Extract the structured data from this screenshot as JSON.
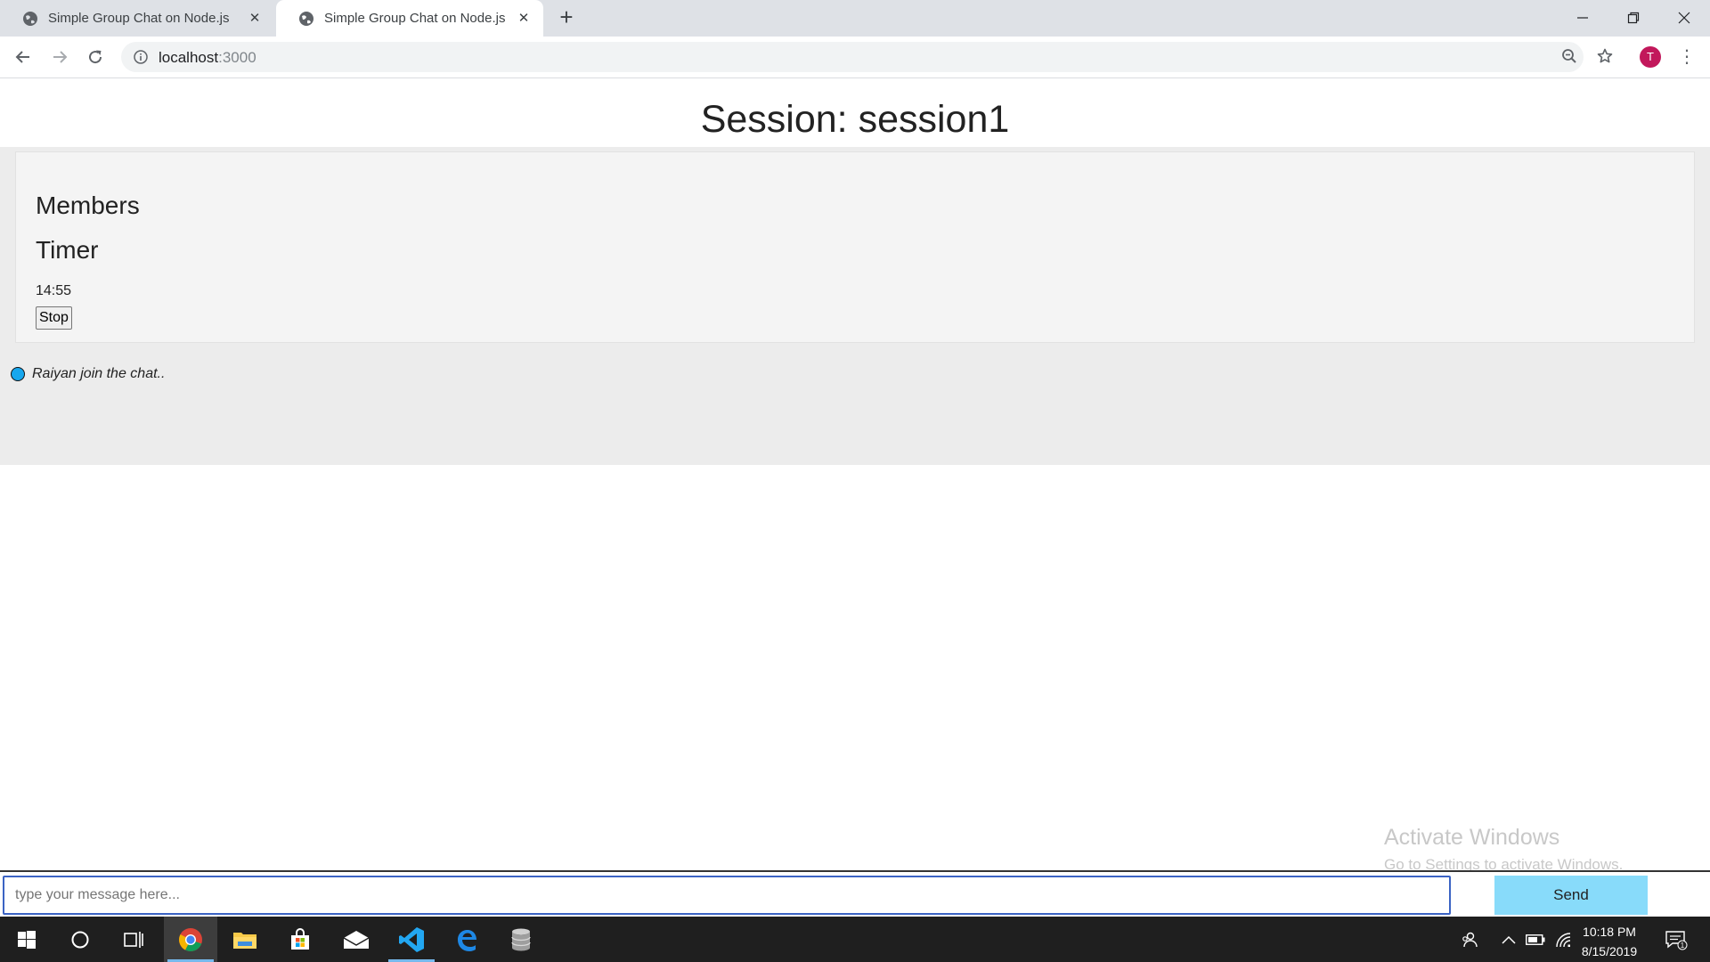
{
  "browser": {
    "tabs": [
      {
        "title": "Simple Group Chat on Node.js",
        "active": false
      },
      {
        "title": "Simple Group Chat on Node.js",
        "active": true
      }
    ],
    "url_host": "localhost",
    "url_port": ":3000",
    "profile_initial": "T",
    "icons": {
      "back": "arrow-left-icon",
      "forward": "arrow-right-icon",
      "reload": "reload-icon",
      "info": "info-icon",
      "zoom": "zoom-out-icon",
      "bookmark": "star-icon",
      "menu": "more-vert-icon"
    }
  },
  "page": {
    "title": "Session: session1",
    "members_heading": "Members",
    "timer_heading": "Timer",
    "timer_value": "14:55",
    "stop_label": "Stop",
    "events": [
      {
        "text": "Raiyan join the chat..",
        "dot_color": "#17a7ee"
      }
    ],
    "message_placeholder": "type your message here...",
    "send_label": "Send"
  },
  "watermark": {
    "title": "Activate Windows",
    "subtitle": "Go to Settings to activate Windows."
  },
  "taskbar": {
    "apps": [
      "windows-start-icon",
      "cortana-icon",
      "task-view-icon",
      "chrome-icon",
      "file-explorer-icon",
      "store-icon",
      "mail-icon",
      "vscode-icon",
      "edge-icon",
      "database-icon"
    ],
    "time": "10:18 PM",
    "date": "8/15/2019",
    "notification_count": "1"
  },
  "colors": {
    "send_button": "#88dbfa",
    "input_focus_border": "#3b63c4",
    "event_dot": "#17a7ee",
    "avatar": "#c2185b"
  }
}
